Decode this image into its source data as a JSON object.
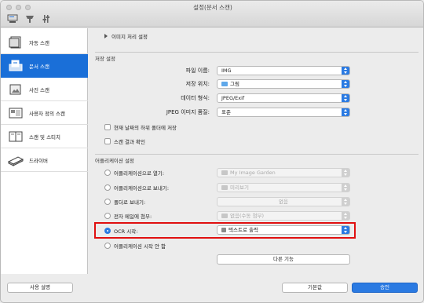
{
  "window": {
    "title": "설정(문서 스캔)"
  },
  "sidebar": {
    "items": [
      {
        "label": "자동 스캔",
        "icon": "auto-scan-icon",
        "active": false
      },
      {
        "label": "문서 스캔",
        "icon": "document-scan-icon",
        "active": true
      },
      {
        "label": "사진 스캔",
        "icon": "photo-scan-icon",
        "active": false
      },
      {
        "label": "사용자 정의 스캔",
        "icon": "custom-scan-icon",
        "active": false
      },
      {
        "label": "스캔 및 스티치",
        "icon": "scan-stitch-icon",
        "active": false
      },
      {
        "label": "드라이버",
        "icon": "driver-icon",
        "active": false
      }
    ]
  },
  "image_processing": {
    "label": "이미지 처리 설정"
  },
  "save_settings": {
    "title": "저장 설정",
    "file_name": {
      "label": "파일 이름:",
      "value": "IMG"
    },
    "save_in": {
      "label": "저장 위치:",
      "value": "그림"
    },
    "data_format": {
      "label": "데이터 형식:",
      "value": "JPEG/Exif"
    },
    "jpeg_quality": {
      "label": "JPEG 이미지 품질:",
      "value": "표준"
    },
    "subfolder_checkbox": "현재 날짜의 하위 폴더에 저장",
    "check_result_checkbox": "스캔 결과 확인"
  },
  "app_settings": {
    "title": "어플리케이션 설정",
    "options": [
      {
        "label": "어플리케이션으로 열기:",
        "value": "My Image Garden",
        "selected": false
      },
      {
        "label": "어플리케이션으로 보내기:",
        "value": "미리보기",
        "selected": false
      },
      {
        "label": "폴더로 보내기:",
        "value": "없음",
        "selected": false
      },
      {
        "label": "전자 메일에 첨부:",
        "value": "없음(수동 첨부)",
        "selected": false
      },
      {
        "label": "OCR 시작:",
        "value": "텍스트로 출력",
        "selected": true
      },
      {
        "label": "어플리케이션 시작 안 함",
        "value": "",
        "selected": false
      }
    ],
    "more_functions": "다른 기능"
  },
  "footer": {
    "instructions": "사용 설명",
    "defaults": "기본값",
    "ok": "승인"
  },
  "colors": {
    "accent": "#2a7ae2",
    "highlight": "#e01010",
    "sidebar_active": "#1a6fd8"
  }
}
